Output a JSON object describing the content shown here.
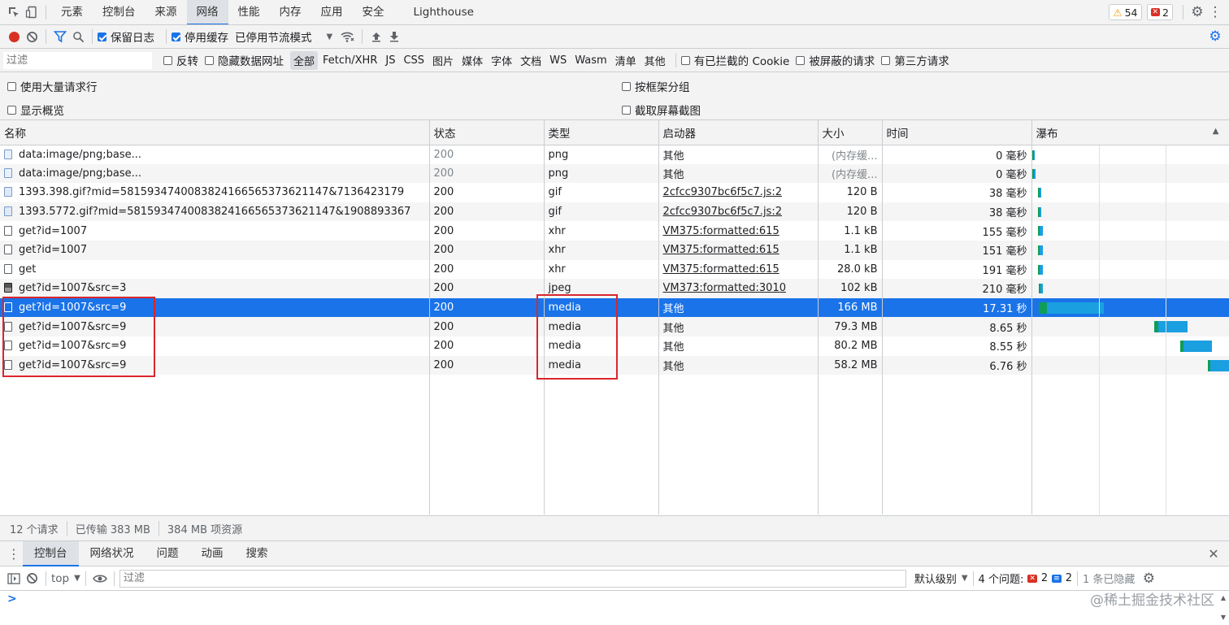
{
  "topbar": {
    "tabs": [
      "元素",
      "控制台",
      "来源",
      "网络",
      "性能",
      "内存",
      "应用",
      "安全",
      "Lighthouse"
    ],
    "active_tab": "网络",
    "warnings": "54",
    "errors": "2"
  },
  "toolbar1": {
    "preserve_log": "保留日志",
    "disable_cache": "停用缓存",
    "throttle": "已停用节流模式"
  },
  "toolbar2": {
    "filter_placeholder": "过滤",
    "invert": "反转",
    "hide_data_urls": "隐藏数据网址",
    "types": [
      "全部",
      "Fetch/XHR",
      "JS",
      "CSS",
      "图片",
      "媒体",
      "字体",
      "文档",
      "WS",
      "Wasm",
      "清单",
      "其他"
    ],
    "active_type": "全部",
    "blocked_cookies": "有已拦截的 Cookie",
    "blocked_requests": "被屏蔽的请求",
    "third_party": "第三方请求"
  },
  "options": {
    "large_rows": "使用大量请求行",
    "group_by_frame": "按框架分组",
    "show_overview": "显示概览",
    "capture_screenshots": "截取屏幕截图"
  },
  "table": {
    "headers": {
      "name": "名称",
      "status": "状态",
      "type": "类型",
      "initiator": "启动器",
      "size": "大小",
      "time": "时间",
      "waterfall": "瀑布"
    },
    "rows": [
      {
        "icon": "img",
        "name": "data:image/png;base...",
        "status": "200",
        "type": "png",
        "initiator": "其他",
        "initiator_link": false,
        "size": "(内存缓...",
        "time": "0 毫秒",
        "dim": true,
        "wf_start": 0.1,
        "wf_len": 0.8
      },
      {
        "icon": "img",
        "name": "data:image/png;base...",
        "status": "200",
        "type": "png",
        "initiator": "其他",
        "initiator_link": false,
        "size": "(内存缓...",
        "time": "0 毫秒",
        "dim": true,
        "wf_start": 0.2,
        "wf_len": 0.8
      },
      {
        "icon": "gif",
        "name": "1393.398.gif?mid=58159347400838241665653736211​47&7136423179",
        "status": "200",
        "type": "gif",
        "initiator": "2cfcc9307bc6f5c7.js:2",
        "initiator_link": true,
        "size": "120 B",
        "time": "38 毫秒",
        "wf_start": 3.0,
        "wf_len": 1.2
      },
      {
        "icon": "gif",
        "name": "1393.5772.gif?mid=58159347400838241665653736211​47&1908893367",
        "status": "200",
        "type": "gif",
        "initiator": "2cfcc9307bc6f5c7.js:2",
        "initiator_link": true,
        "size": "120 B",
        "time": "38 毫秒",
        "wf_start": 3.0,
        "wf_len": 1.2
      },
      {
        "icon": "doc",
        "name": "get?id=1007",
        "status": "200",
        "type": "xhr",
        "initiator": "VM375:formatted:615",
        "initiator_link": true,
        "size": "1.1 kB",
        "time": "155 毫秒",
        "wf_start": 3.2,
        "wf_len": 1.6
      },
      {
        "icon": "doc",
        "name": "get?id=1007",
        "status": "200",
        "type": "xhr",
        "initiator": "VM375:formatted:615",
        "initiator_link": true,
        "size": "1.1 kB",
        "time": "151 毫秒",
        "wf_start": 3.2,
        "wf_len": 1.6
      },
      {
        "icon": "doc",
        "name": "get",
        "status": "200",
        "type": "xhr",
        "initiator": "VM375:formatted:615",
        "initiator_link": true,
        "size": "28.0 kB",
        "time": "191 毫秒",
        "wf_start": 3.2,
        "wf_len": 1.6
      },
      {
        "icon": "jpeg",
        "name": "get?id=1007&src=3",
        "status": "200",
        "type": "jpeg",
        "initiator": "VM373:formatted:3010",
        "initiator_link": true,
        "size": "102 kB",
        "time": "210 毫秒",
        "wf_start": 3.3,
        "wf_len": 1.5
      },
      {
        "icon": "doc",
        "name": "get?id=1007&src=9",
        "status": "200",
        "type": "media",
        "initiator": "其他",
        "initiator_link": false,
        "size": "166 MB",
        "time": "17.31 秒",
        "selected": true,
        "wf_start": 3.6,
        "wf_len": 33
      },
      {
        "icon": "doc",
        "name": "get?id=1007&src=9",
        "status": "200",
        "type": "media",
        "initiator": "其他",
        "initiator_link": false,
        "size": "79.3 MB",
        "time": "8.65 秒",
        "wf_start": 62,
        "wf_len": 17
      },
      {
        "icon": "doc",
        "name": "get?id=1007&src=9",
        "status": "200",
        "type": "media",
        "initiator": "其他",
        "initiator_link": false,
        "size": "80.2 MB",
        "time": "8.55 秒",
        "wf_start": 75,
        "wf_len": 16
      },
      {
        "icon": "doc",
        "name": "get?id=1007&src=9",
        "status": "200",
        "type": "media",
        "initiator": "其他",
        "initiator_link": false,
        "size": "58.2 MB",
        "time": "6.76 秒",
        "wf_start": 89,
        "wf_len": 11
      }
    ]
  },
  "status": {
    "requests": "12 个请求",
    "transferred": "已传输 383 MB",
    "resources": "384 MB 项资源"
  },
  "drawer": {
    "tabs": [
      "控制台",
      "网络状况",
      "问题",
      "动画",
      "搜索"
    ],
    "active_tab": "控制台",
    "context": "top",
    "filter_placeholder": "过滤",
    "level": "默认级别",
    "issues_label": "4 个问题:",
    "issues_errors": "2",
    "issues_info": "2",
    "hidden": "1 条已隐藏"
  },
  "prompt": ">",
  "watermark": "@稀土掘金技术社区",
  "colors": {
    "accent": "#1a73e8",
    "highlight": "#d9262c",
    "waterfall_green": "#0f9d58",
    "waterfall_blue": "#1a9fe0"
  }
}
